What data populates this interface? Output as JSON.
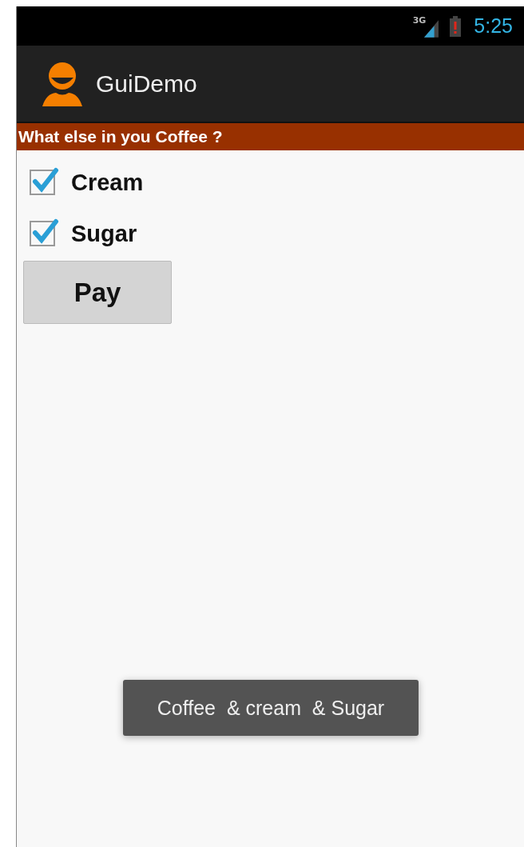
{
  "status_bar": {
    "network": "3G",
    "time": "5:25"
  },
  "action_bar": {
    "title": "GuiDemo"
  },
  "header": "What else in you Coffee ?",
  "options": [
    {
      "label": "Cream",
      "checked": true
    },
    {
      "label": "Sugar",
      "checked": true
    }
  ],
  "button": "Pay",
  "toast": "Coffee  & cream  & Sugar"
}
